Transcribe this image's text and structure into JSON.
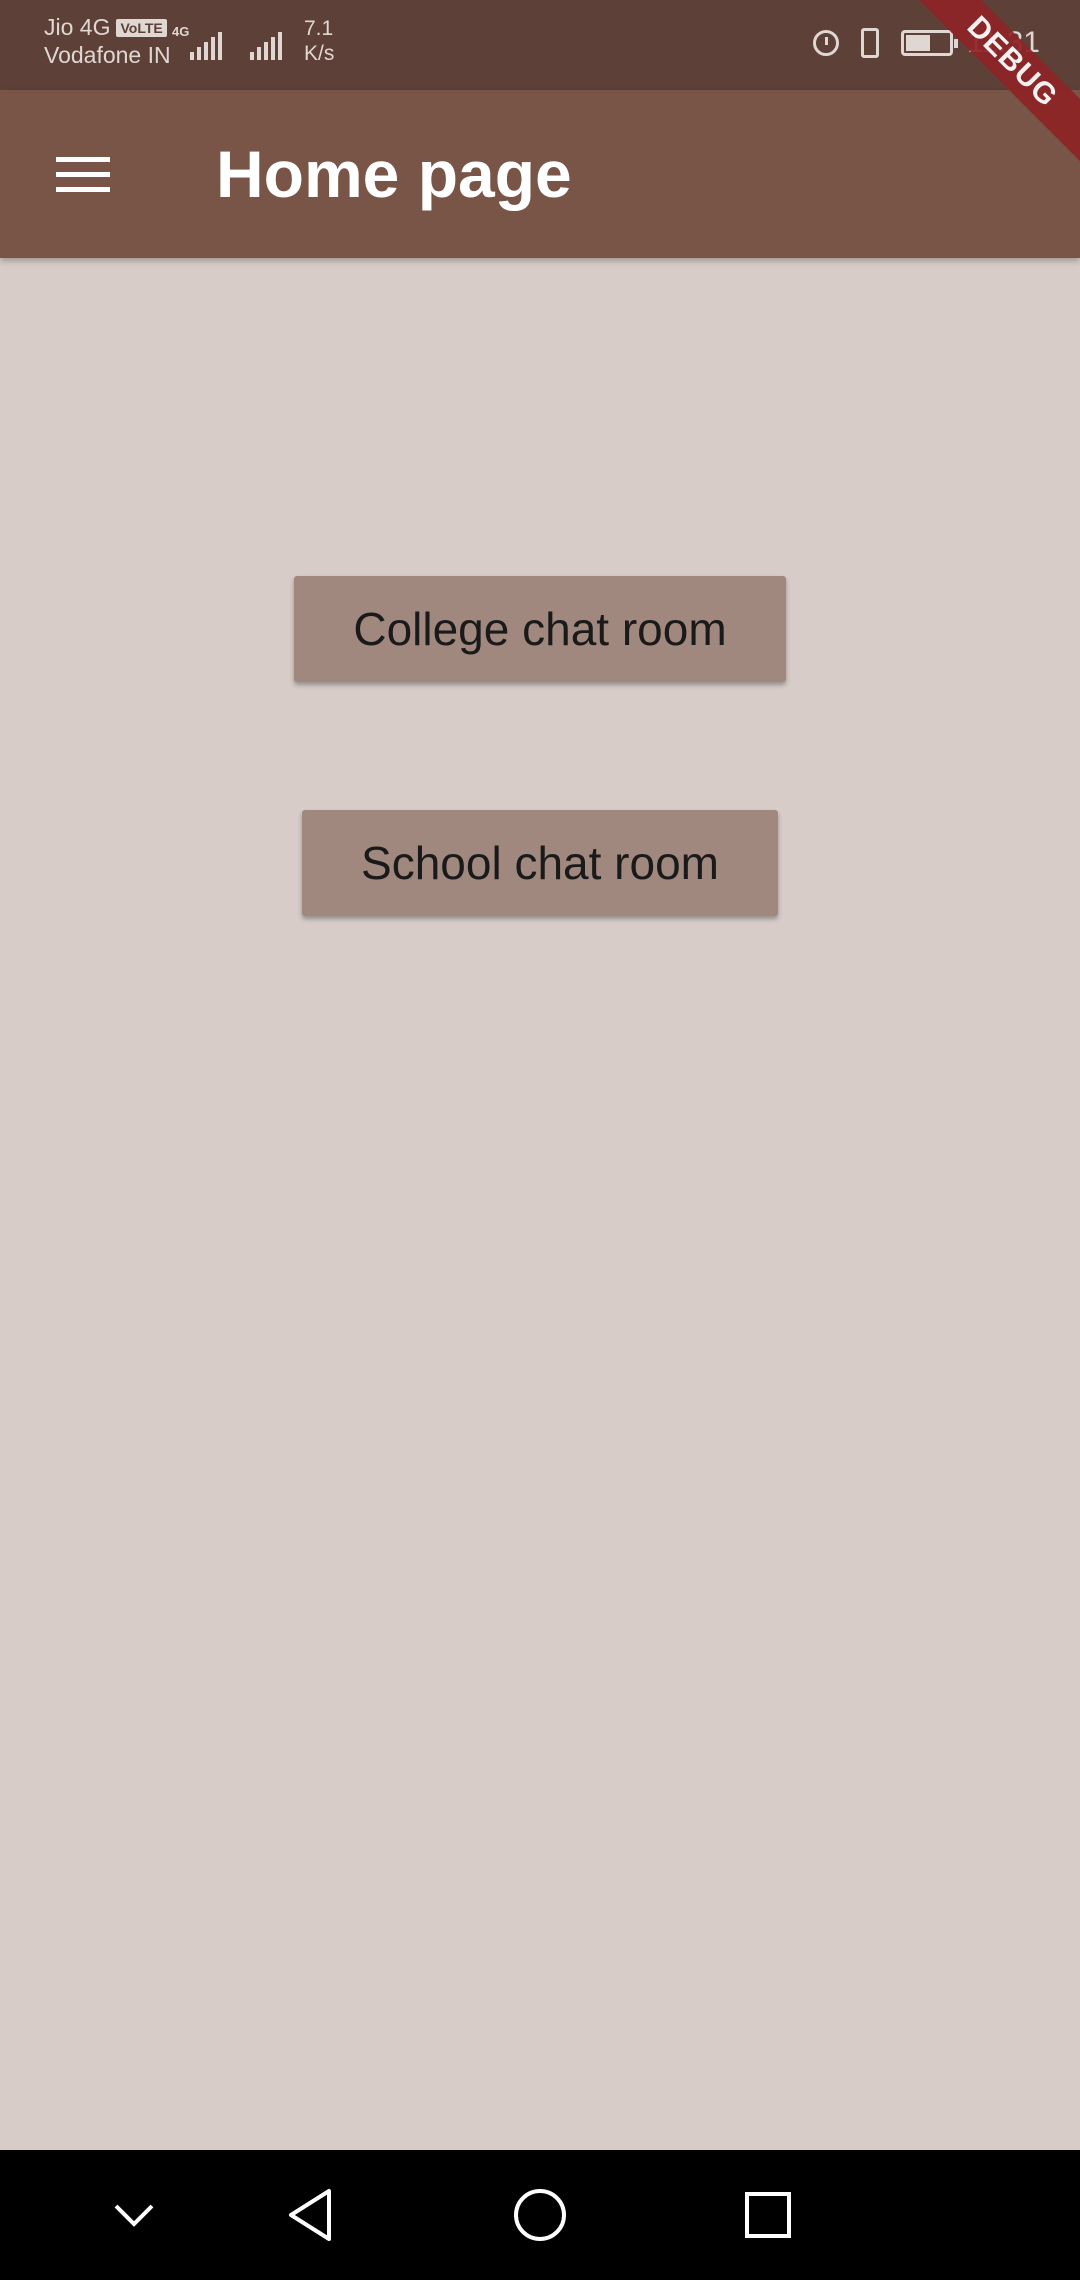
{
  "status_bar": {
    "carrier_1": "Jio 4G",
    "volte_badge": "VoLTE",
    "carrier_2": "Vodafone IN",
    "network_type": "4G",
    "speed_value": "7.1",
    "speed_unit": "K/s",
    "clock": "11:31",
    "icons": [
      "signal-icon",
      "alarm-icon",
      "vibrate-icon",
      "battery-icon"
    ]
  },
  "app_bar": {
    "title": "Home page",
    "menu_icon": "hamburger-menu-icon"
  },
  "debug_banner": "DEBUG",
  "main": {
    "buttons": [
      {
        "label": "College chat room"
      },
      {
        "label": "School chat room"
      }
    ]
  },
  "nav_bar": {
    "icons": [
      "chevron-down-icon",
      "back-icon",
      "home-icon",
      "recent-apps-icon"
    ]
  },
  "colors": {
    "status_bar": "#5d4037",
    "app_bar": "#795548",
    "background": "#d7ccc8",
    "button": "#a1887f",
    "debug_ribbon": "#8e2426"
  }
}
